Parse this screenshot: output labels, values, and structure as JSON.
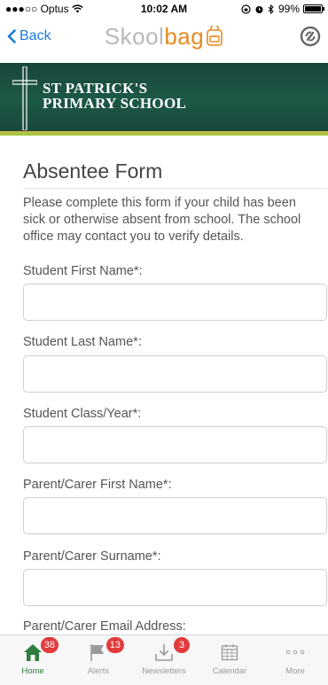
{
  "status_bar": {
    "carrier": "●●●○○ Optus",
    "time": "10:02 AM",
    "battery": "99%"
  },
  "nav": {
    "back_label": "Back",
    "logo_prefix": "Skool",
    "logo_accent": "bag"
  },
  "banner": {
    "line1": "ST PATRICK'S",
    "line2": "PRIMARY SCHOOL"
  },
  "form": {
    "title": "Absentee Form",
    "intro": "Please complete this form if your child has been sick or otherwise absent from school. The school office may contact you to verify details.",
    "fields": [
      {
        "label": "Student First Name*:",
        "value": ""
      },
      {
        "label": "Student Last Name*:",
        "value": ""
      },
      {
        "label": "Student Class/Year*:",
        "value": ""
      },
      {
        "label": "Parent/Carer First Name*:",
        "value": ""
      },
      {
        "label": "Parent/Carer Surname*:",
        "value": ""
      },
      {
        "label": "Parent/Carer Email Address:",
        "value": ""
      }
    ]
  },
  "tabs": [
    {
      "label": "Home",
      "badge": "38",
      "icon": "home-icon",
      "active": true
    },
    {
      "label": "Alerts",
      "badge": "13",
      "icon": "flag-icon",
      "active": false
    },
    {
      "label": "Newsletters",
      "badge": "3",
      "icon": "download-tray-icon",
      "active": false
    },
    {
      "label": "Calendar",
      "badge": "",
      "icon": "calendar-icon",
      "active": false
    },
    {
      "label": "More",
      "badge": "",
      "icon": "more-icon",
      "active": false
    }
  ],
  "colors": {
    "link_blue": "#1a7bd9",
    "brand_orange": "#e58a1f",
    "banner_green": "#1d5847",
    "active_tab_green": "#2e7d3e",
    "badge_red": "#e23b3b"
  }
}
